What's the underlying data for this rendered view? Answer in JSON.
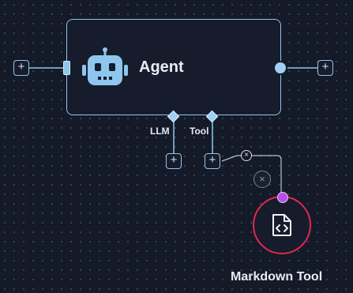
{
  "agent_node": {
    "title": "Agent",
    "icon": "robot-icon",
    "ports": {
      "llm_label": "LLM",
      "tool_label": "Tool"
    }
  },
  "add_buttons": {
    "symbol": "+"
  },
  "tool_node": {
    "label": "Markdown Tool",
    "icon": "markdown-file-icon",
    "accent_color": "#e0294d"
  },
  "edge_controls": {
    "delete_symbol": "×"
  },
  "colors": {
    "canvas": "#141a27",
    "node_border": "#8ec6ee",
    "handle_purple": "#b64fe8"
  }
}
